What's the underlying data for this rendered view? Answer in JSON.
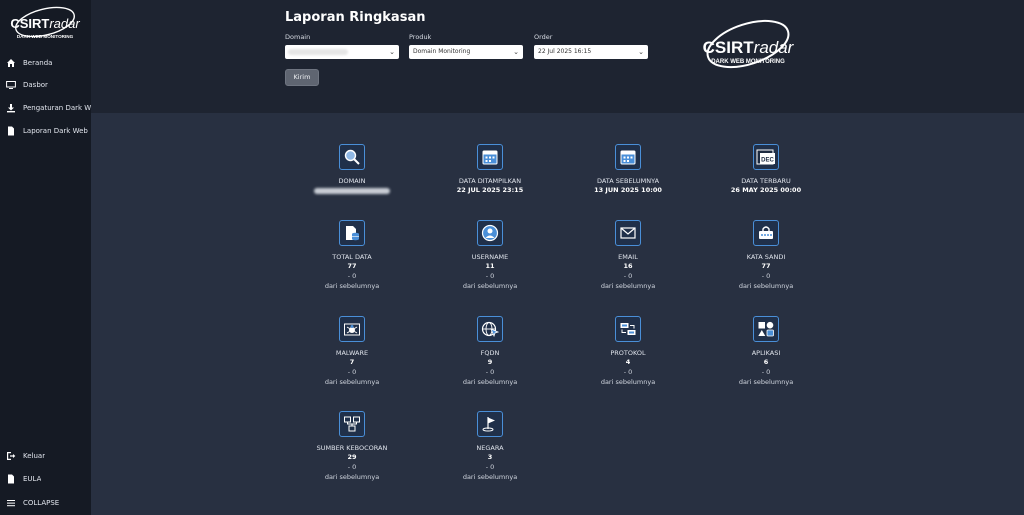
{
  "brand": {
    "name_bold": "CSIRT",
    "name_light": "radar",
    "tagline": "DARK WEB MONITORING"
  },
  "sidebar": {
    "items": [
      {
        "label": "Beranda",
        "icon": "home-icon"
      },
      {
        "label": "Dasbor",
        "icon": "monitor-icon"
      },
      {
        "label": "Pengaturan Dark Web",
        "icon": "download-icon"
      },
      {
        "label": "Laporan Dark Web",
        "icon": "document-icon"
      }
    ],
    "bottom": [
      {
        "label": "Keluar",
        "icon": "logout-icon"
      },
      {
        "label": "EULA",
        "icon": "document-icon"
      },
      {
        "label": "COLLAPSE",
        "icon": "menu-icon"
      }
    ]
  },
  "header": {
    "title": "Laporan Ringkasan",
    "domain_label": "Domain",
    "domain_value": "",
    "produk_label": "Produk",
    "produk_value": "Domain Monitoring",
    "order_label": "Order",
    "order_value": "22 Jul 2025 16:15",
    "submit_label": "Kirim"
  },
  "summary": {
    "row1": [
      {
        "title": "DOMAIN",
        "value": "",
        "icon": "search-icon"
      },
      {
        "title": "DATA DITAMPILKAN",
        "value": "22 JUL 2025 23:15",
        "icon": "calendar-icon"
      },
      {
        "title": "DATA SEBELUMNYA",
        "value": "13 JUN 2025 10:00",
        "icon": "calendar-icon"
      },
      {
        "title": "DATA TERBARU",
        "value": "26 MAY 2025 00:00",
        "icon": "calendar-dec-icon",
        "icon_text": "DEC"
      }
    ],
    "stats": [
      {
        "title": "TOTAL DATA",
        "value": "77",
        "delta": "- 0",
        "note": "dari sebelumnya",
        "icon": "database-icon"
      },
      {
        "title": "USERNAME",
        "value": "11",
        "delta": "- 0",
        "note": "dari sebelumnya",
        "icon": "user-icon"
      },
      {
        "title": "EMAIL",
        "value": "16",
        "delta": "- 0",
        "note": "dari sebelumnya",
        "icon": "email-icon"
      },
      {
        "title": "KATA SANDI",
        "value": "77",
        "delta": "- 0",
        "note": "dari sebelumnya",
        "icon": "password-icon"
      },
      {
        "title": "MALWARE",
        "value": "7",
        "delta": "- 0",
        "note": "dari sebelumnya",
        "icon": "malware-icon"
      },
      {
        "title": "FQDN",
        "value": "9",
        "delta": "- 0",
        "note": "dari sebelumnya",
        "icon": "globe-icon"
      },
      {
        "title": "PROTOKOL",
        "value": "4",
        "delta": "- 0",
        "note": "dari sebelumnya",
        "icon": "protocol-icon"
      },
      {
        "title": "APLIKASI",
        "value": "6",
        "delta": "- 0",
        "note": "dari sebelumnya",
        "icon": "apps-icon"
      },
      {
        "title": "SUMBER KEBOCORAN",
        "value": "29",
        "delta": "- 0",
        "note": "dari sebelumnya",
        "icon": "network-icon"
      },
      {
        "title": "NEGARA",
        "value": "3",
        "delta": "- 0",
        "note": "dari sebelumnya",
        "icon": "flag-icon"
      }
    ]
  },
  "colors": {
    "sidebar": "#151a24",
    "header": "#1e2431",
    "content": "#283041",
    "accent": "#4a8fd8"
  }
}
